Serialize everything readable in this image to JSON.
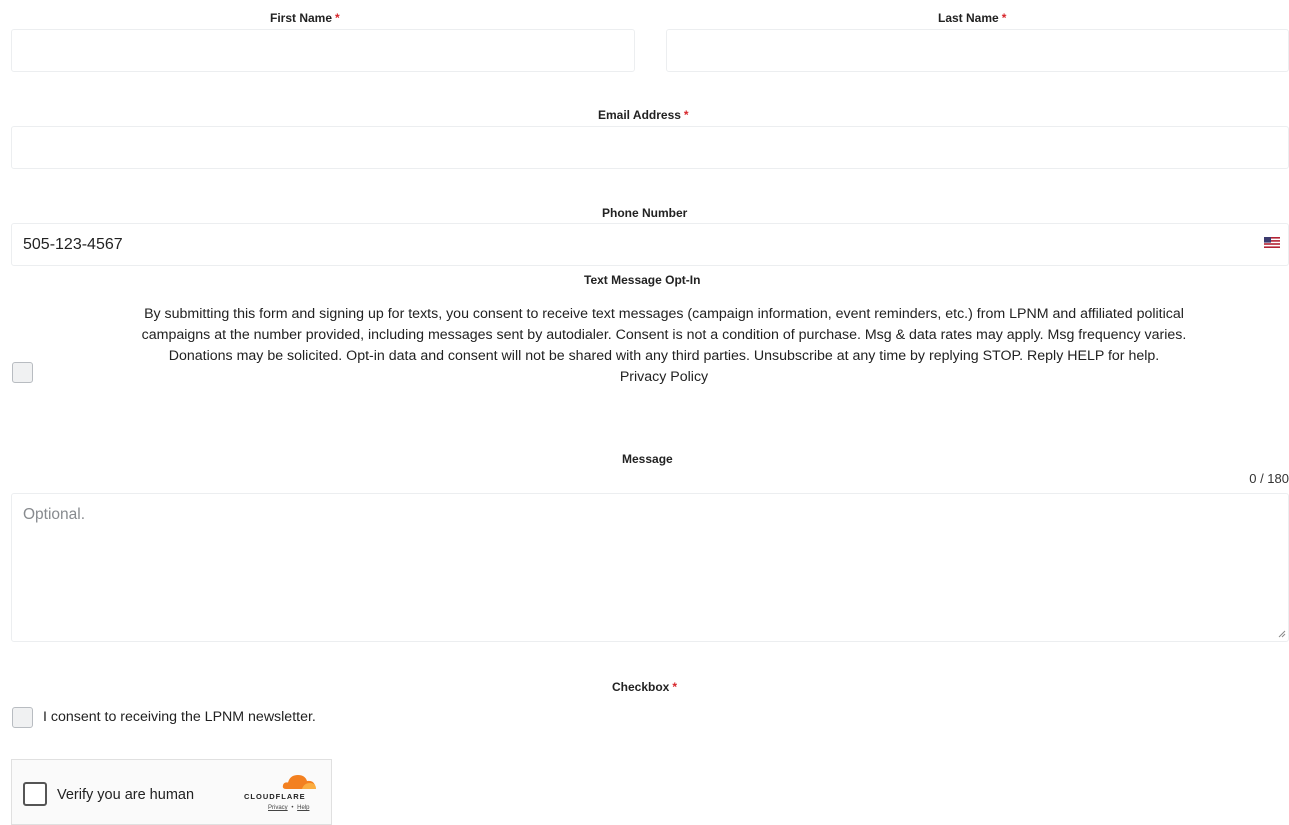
{
  "form": {
    "first_name": {
      "label": "First Name",
      "required_mark": "*",
      "value": ""
    },
    "last_name": {
      "label": "Last Name",
      "required_mark": "*",
      "value": ""
    },
    "email": {
      "label": "Email Address",
      "required_mark": "*",
      "value": ""
    },
    "phone": {
      "label": "Phone Number",
      "value": "505-123-4567",
      "flag_icon": "us-flag-icon"
    },
    "sms_opt_in": {
      "label": "Text Message Opt-In",
      "checked": false,
      "lines": [
        "By submitting this form and signing up for texts, you consent to receive text messages (campaign information, event reminders, etc.) from LPNM and affiliated political",
        "campaigns at the number provided, including messages sent by autodialer. Consent is not a condition of purchase. Msg & data rates may apply. Msg frequency varies.",
        "Donations may be solicited. Opt-in data and consent will not be shared with any third parties. Unsubscribe at any time by replying STOP. Reply HELP for help."
      ],
      "privacy_link": "Privacy Policy"
    },
    "message": {
      "label": "Message",
      "counter": "0 / 180",
      "placeholder": "Optional.",
      "value": ""
    },
    "checkbox": {
      "label": "Checkbox",
      "required_mark": "*",
      "option_label": "I consent to receiving the LPNM newsletter.",
      "checked": false
    },
    "captcha": {
      "label": "Verify you are human",
      "brand": "CLOUDFLARE",
      "privacy": "Privacy",
      "separator": "•",
      "help": "Help",
      "brand_icon": "cloudflare-cloud-icon"
    }
  },
  "colors": {
    "required": "#d7262b",
    "cloudflare_orange": "#f38020",
    "field_border": "#eceef0"
  }
}
